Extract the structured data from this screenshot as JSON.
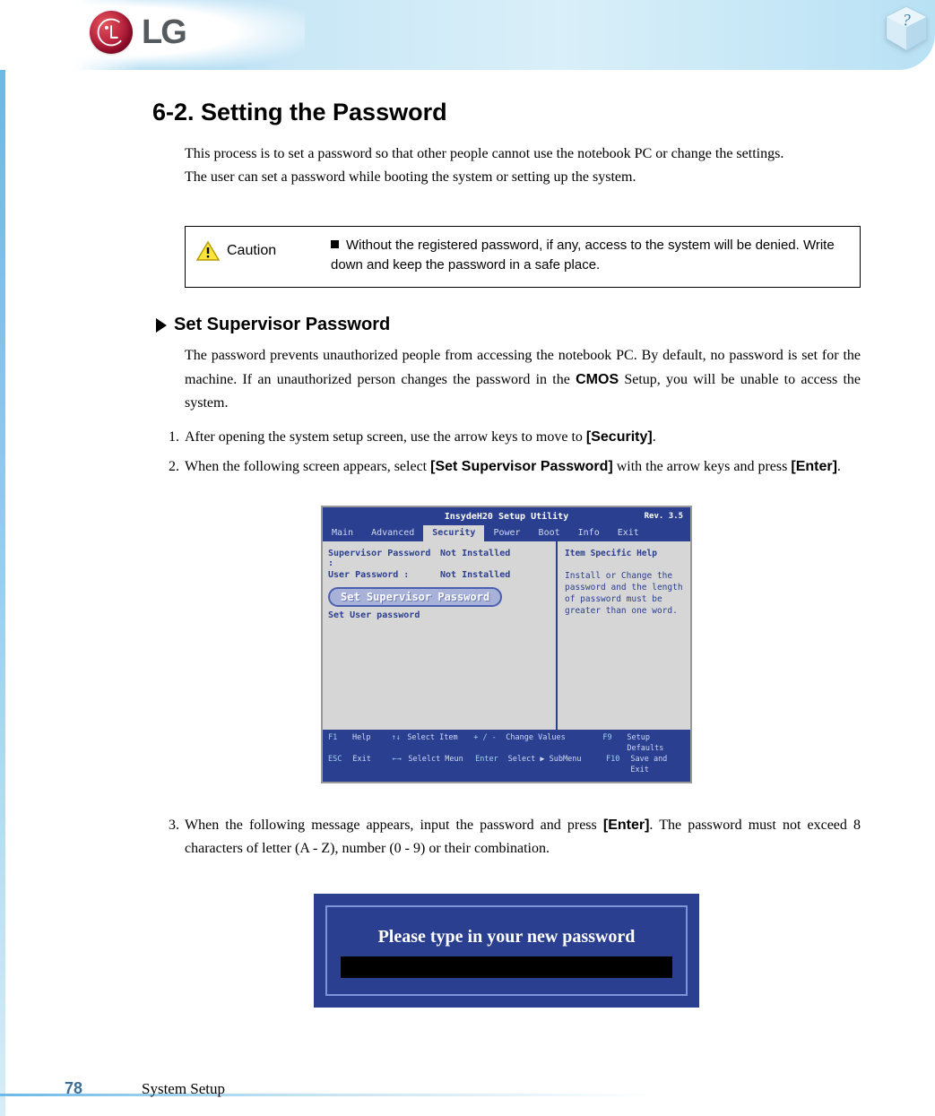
{
  "header": {
    "brand": "LG"
  },
  "page": {
    "number": "78",
    "section": "System Setup"
  },
  "title": "6-2. Setting the Password",
  "intro_line1": "This process is to set a password so that other people cannot use the notebook PC or change the settings.",
  "intro_line2": "The user can set a password while booting the system or setting up the system.",
  "caution": {
    "label": "Caution",
    "text": "Without the registered password, if any, access to the system will be denied. Write down and keep the password in a safe place."
  },
  "section1": {
    "heading": "Set Supervisor Password",
    "para_a": "The password prevents unauthorized people from accessing the notebook PC. By default, no password is set for the machine. If an unauthorized person changes the password in the ",
    "para_b_bold": "CMOS",
    "para_c": " Setup, you will be unable to access the system.",
    "step1_a": "After opening the system setup screen, use the arrow keys to move to ",
    "step1_b_bold": "[Security]",
    "step1_c": ".",
    "step2_a": "When the following screen appears, select ",
    "step2_b_bold": "[Set Supervisor Password]",
    "step2_c": " with the arrow keys and press ",
    "step2_d_bold": "[Enter]",
    "step2_e": ".",
    "step3_a": "When the following message appears, input the password and press ",
    "step3_b_bold": "[Enter]",
    "step3_c": ". The password must not exceed 8 characters of letter (A - Z), number (0 - 9) or their combination."
  },
  "bios": {
    "title": "InsydeH20 Setup Utility",
    "rev": "Rev. 3.5",
    "tabs": [
      "Main",
      "Advanced",
      "Security",
      "Power",
      "Boot",
      "Info",
      "Exit"
    ],
    "active_tab": "Security",
    "rows": [
      {
        "label": "Supervisor Password :",
        "value": "Not Installed"
      },
      {
        "label": "User Password        :",
        "value": "Not Installed"
      }
    ],
    "highlighted": "Set Supervisor Password",
    "below": "Set User password",
    "help_title": "Item Specific Help",
    "help_text": "Install or Change the password and the length of password must be greater than one word.",
    "footer": {
      "r1": [
        {
          "k": "F1",
          "l": "Help"
        },
        {
          "k": "↑↓",
          "l": "Select Item"
        },
        {
          "k": "+ / -",
          "l": "Change Values"
        },
        {
          "k": "F9",
          "l": "Setup Defaults"
        }
      ],
      "r2": [
        {
          "k": "ESC",
          "l": "Exit"
        },
        {
          "k": "←→",
          "l": "Selelct Meun"
        },
        {
          "k": "Enter",
          "l": "Select ▶ SubMenu"
        },
        {
          "k": "F10",
          "l": "Save and Exit"
        }
      ]
    }
  },
  "password_dialog": {
    "prompt": "Please type in your new password"
  }
}
